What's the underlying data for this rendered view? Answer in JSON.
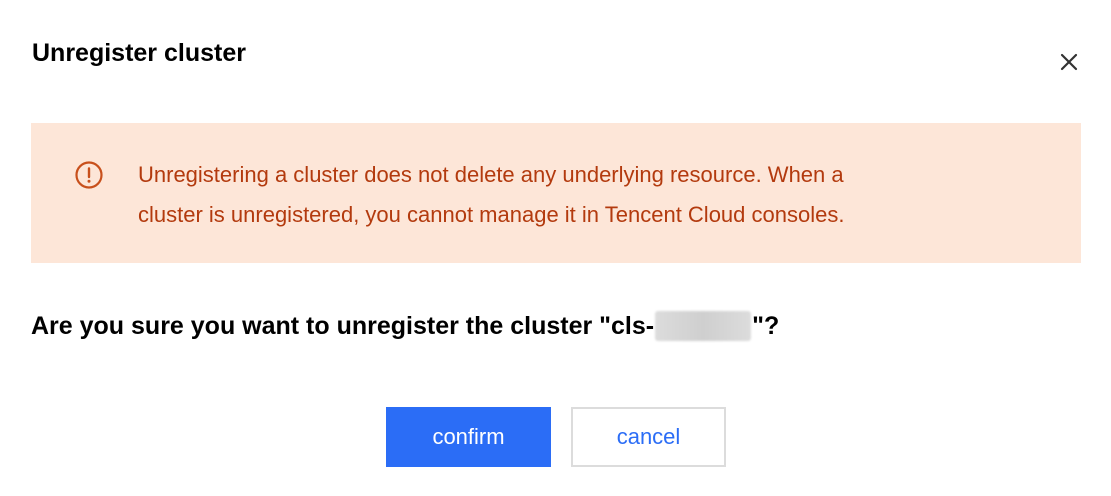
{
  "dialog": {
    "title": "Unregister cluster",
    "close_icon": "close-icon"
  },
  "alert": {
    "icon": "exclamation-circle-icon",
    "line1": "Unregistering a cluster does not delete any underlying resource. When a",
    "line2": "cluster is unregistered, you cannot manage it in Tencent Cloud consoles.",
    "text_color": "#b33a0e",
    "background_color": "#fde6d8"
  },
  "question": {
    "prefix": "Are you sure you want to unregister the cluster \"cls-",
    "suffix": "\"?"
  },
  "buttons": {
    "confirm_label": "confirm",
    "cancel_label": "cancel"
  },
  "colors": {
    "primary": "#2b6df6",
    "border": "#dcdcdc"
  }
}
